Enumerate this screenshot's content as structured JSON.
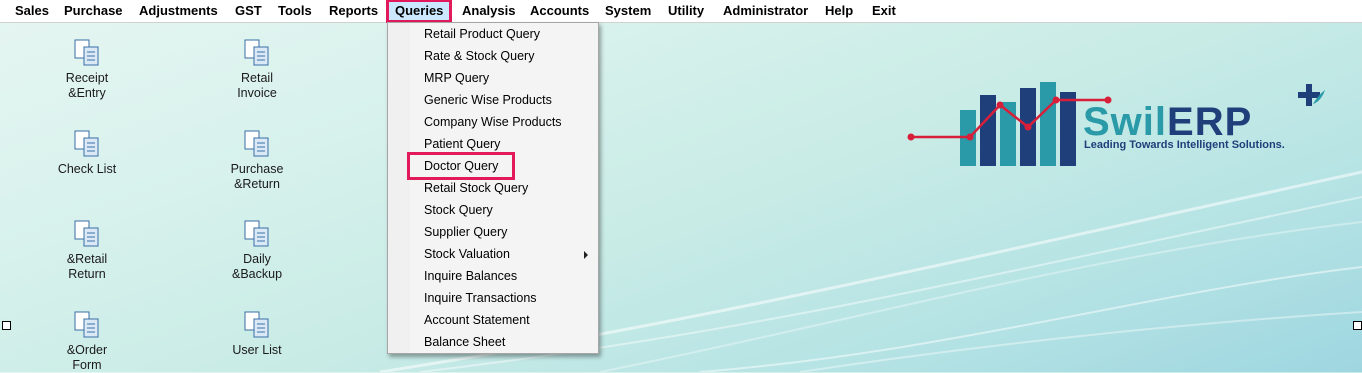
{
  "menubar": {
    "items": [
      "Sales",
      "Purchase",
      "Adjustments",
      "GST",
      "Tools",
      "Reports",
      "Queries",
      "Analysis",
      "Accounts",
      "System",
      "Utility",
      "Administrator",
      "Help",
      "Exit"
    ],
    "active": "Queries"
  },
  "shortcuts": [
    {
      "label": "Receipt\n&Entry",
      "icon": "document-icon"
    },
    {
      "label": "Retail\nInvoice",
      "icon": "document-icon"
    },
    {
      "label": "Check List",
      "icon": "document-icon"
    },
    {
      "label": "Purchase\n&Return",
      "icon": "document-icon"
    },
    {
      "label": "&Retail\nReturn",
      "icon": "document-icon"
    },
    {
      "label": "Daily\n&Backup",
      "icon": "document-icon"
    },
    {
      "label": "&Order\nForm",
      "icon": "document-icon"
    },
    {
      "label": "User List",
      "icon": "document-icon"
    }
  ],
  "queries_menu": {
    "items": [
      "Retail Product Query",
      "Rate & Stock Query",
      "MRP Query",
      "Generic Wise Products",
      "Company Wise Products",
      "Patient Query",
      "Doctor Query",
      "Retail Stock Query",
      "Stock Query",
      "Supplier Query",
      "Stock Valuation",
      "Inquire Balances",
      "Inquire Transactions",
      "Account Statement",
      "Balance Sheet"
    ],
    "highlighted": "Doctor Query",
    "submenu_item": "Stock Valuation"
  },
  "logo": {
    "brand_part1": "Swil",
    "brand_part2": "ERP",
    "tagline": "Leading Towards Intelligent Solutions."
  },
  "colors": {
    "highlight_border": "#e2195b",
    "logo_teal": "#2a9aa8",
    "logo_navy": "#1f3f7a",
    "logo_red": "#d81f3a"
  }
}
